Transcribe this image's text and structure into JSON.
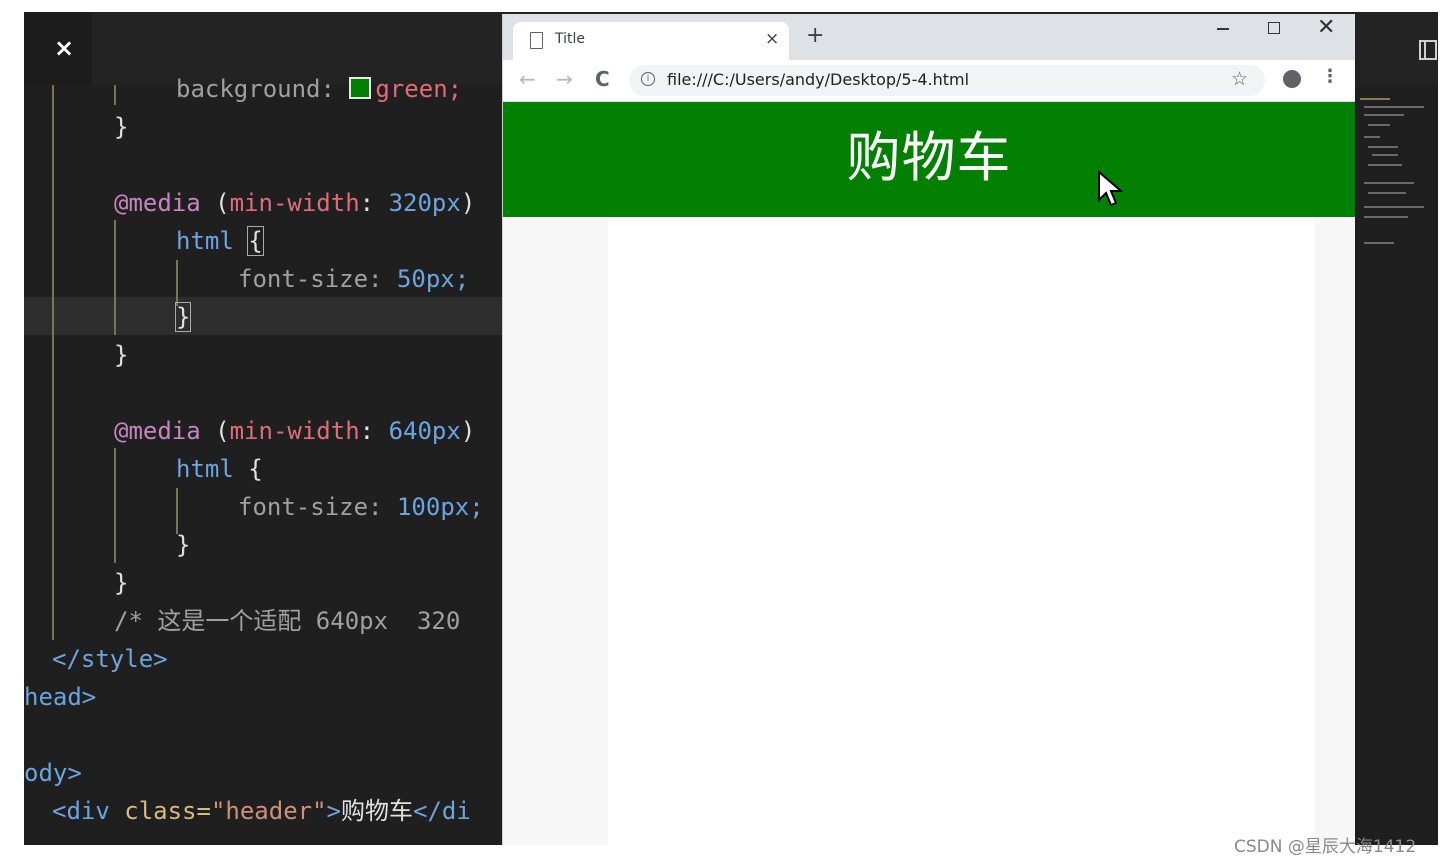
{
  "editor": {
    "close_symbol": "×",
    "lines": {
      "l1_prop": "background: ",
      "l1_val": "green;",
      "l2": "}",
      "l3_at": "@media",
      "l3_open": " (",
      "l3_prop": "min-width",
      "l3_colon": ": ",
      "l3_num": "320",
      "l3_unit": "px",
      "l3_close": ")",
      "l4_sel": "html ",
      "l4_brace": "{",
      "l5_prop": "font-size: ",
      "l5_num": "50",
      "l5_unit": "px;",
      "l6": "}",
      "l7": "}",
      "l8_at": "@media",
      "l8_open": " (",
      "l8_prop": "min-width",
      "l8_colon": ": ",
      "l8_num": "640",
      "l8_unit": "px",
      "l8_close": ")",
      "l9_sel": "html ",
      "l9_brace": "{",
      "l10_prop": "font-size: ",
      "l10_num": "100",
      "l10_unit": "px;",
      "l11": "}",
      "l12": "}",
      "l13": "/* 这是一个适配 640px  320",
      "l14": "</style>",
      "l15": "head>",
      "l16": "ody>",
      "l17_tag": "<div ",
      "l17_attr": "class=",
      "l17_str": "\"header\"",
      "l17_gt": ">",
      "l17_text": "购物车",
      "l17_end": "</di"
    }
  },
  "browser": {
    "tab_title": "Title",
    "tab_close": "×",
    "new_tab": "+",
    "window_close": "✕",
    "back": "←",
    "forward": "→",
    "reload": "C",
    "url": "file:///C:/Users/andy/Desktop/5-4.html",
    "star": "☆",
    "menu": "⋮",
    "info": "i"
  },
  "page": {
    "header_text": "购物车",
    "header_color": "#018001"
  },
  "watermark": "CSDN @星辰大海1412"
}
